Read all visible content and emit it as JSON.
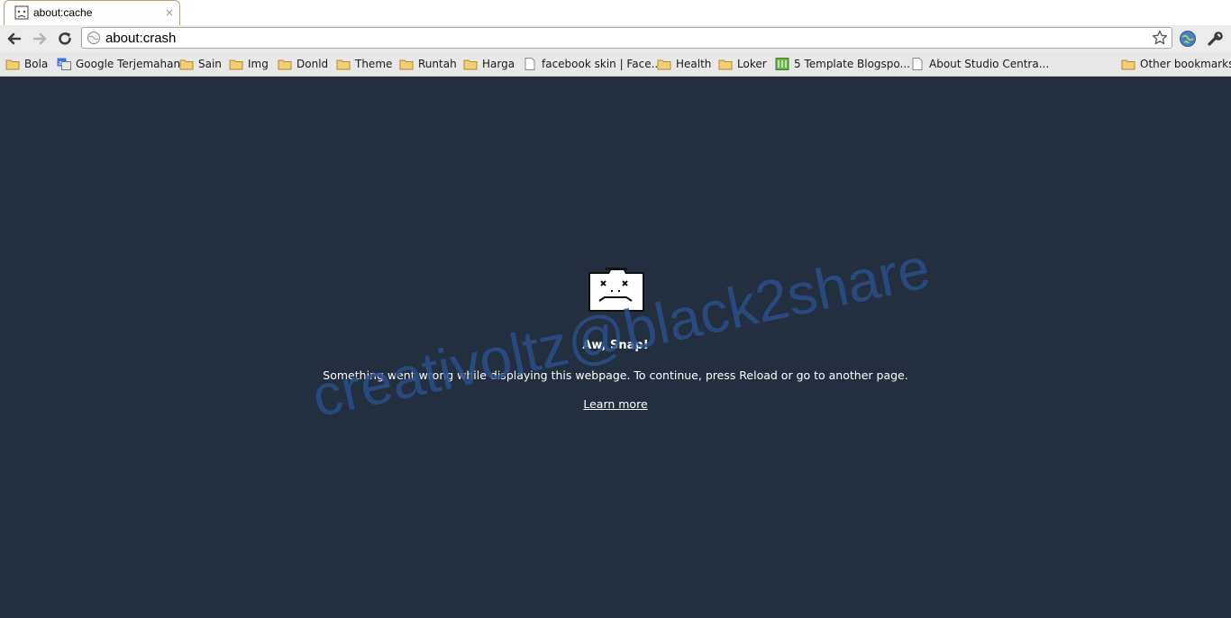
{
  "tab": {
    "title": "about:cache",
    "close": "×"
  },
  "toolbar": {
    "url": "about:crash"
  },
  "bookmarks": [
    {
      "label": "Bola",
      "icon": "folder-icon"
    },
    {
      "label": "Google Terjemahan",
      "icon": "translate-icon"
    },
    {
      "label": "Sain",
      "icon": "folder-icon"
    },
    {
      "label": "Img",
      "icon": "folder-icon"
    },
    {
      "label": "Donld",
      "icon": "folder-icon"
    },
    {
      "label": "Theme",
      "icon": "folder-icon"
    },
    {
      "label": "Runtah",
      "icon": "folder-icon"
    },
    {
      "label": "Harga",
      "icon": "folder-icon"
    },
    {
      "label": "facebook skin | Face...",
      "icon": "page-icon"
    },
    {
      "label": "Health",
      "icon": "folder-icon"
    },
    {
      "label": "Loker",
      "icon": "folder-icon"
    },
    {
      "label": "5 Template Blogspo...",
      "icon": "site-icon"
    },
    {
      "label": "About Studio Centra...",
      "icon": "page-icon"
    }
  ],
  "other_bookmarks": "Other bookmarks",
  "error": {
    "title": "Aw, Snap!",
    "message": "Something went wrong while displaying this webpage. To continue, press Reload or go to another page.",
    "link": "Learn more"
  },
  "watermark": "creativoltz@black2share",
  "colors": {
    "content_bg": "#232f3f",
    "watermark": "#2b4f8a"
  }
}
